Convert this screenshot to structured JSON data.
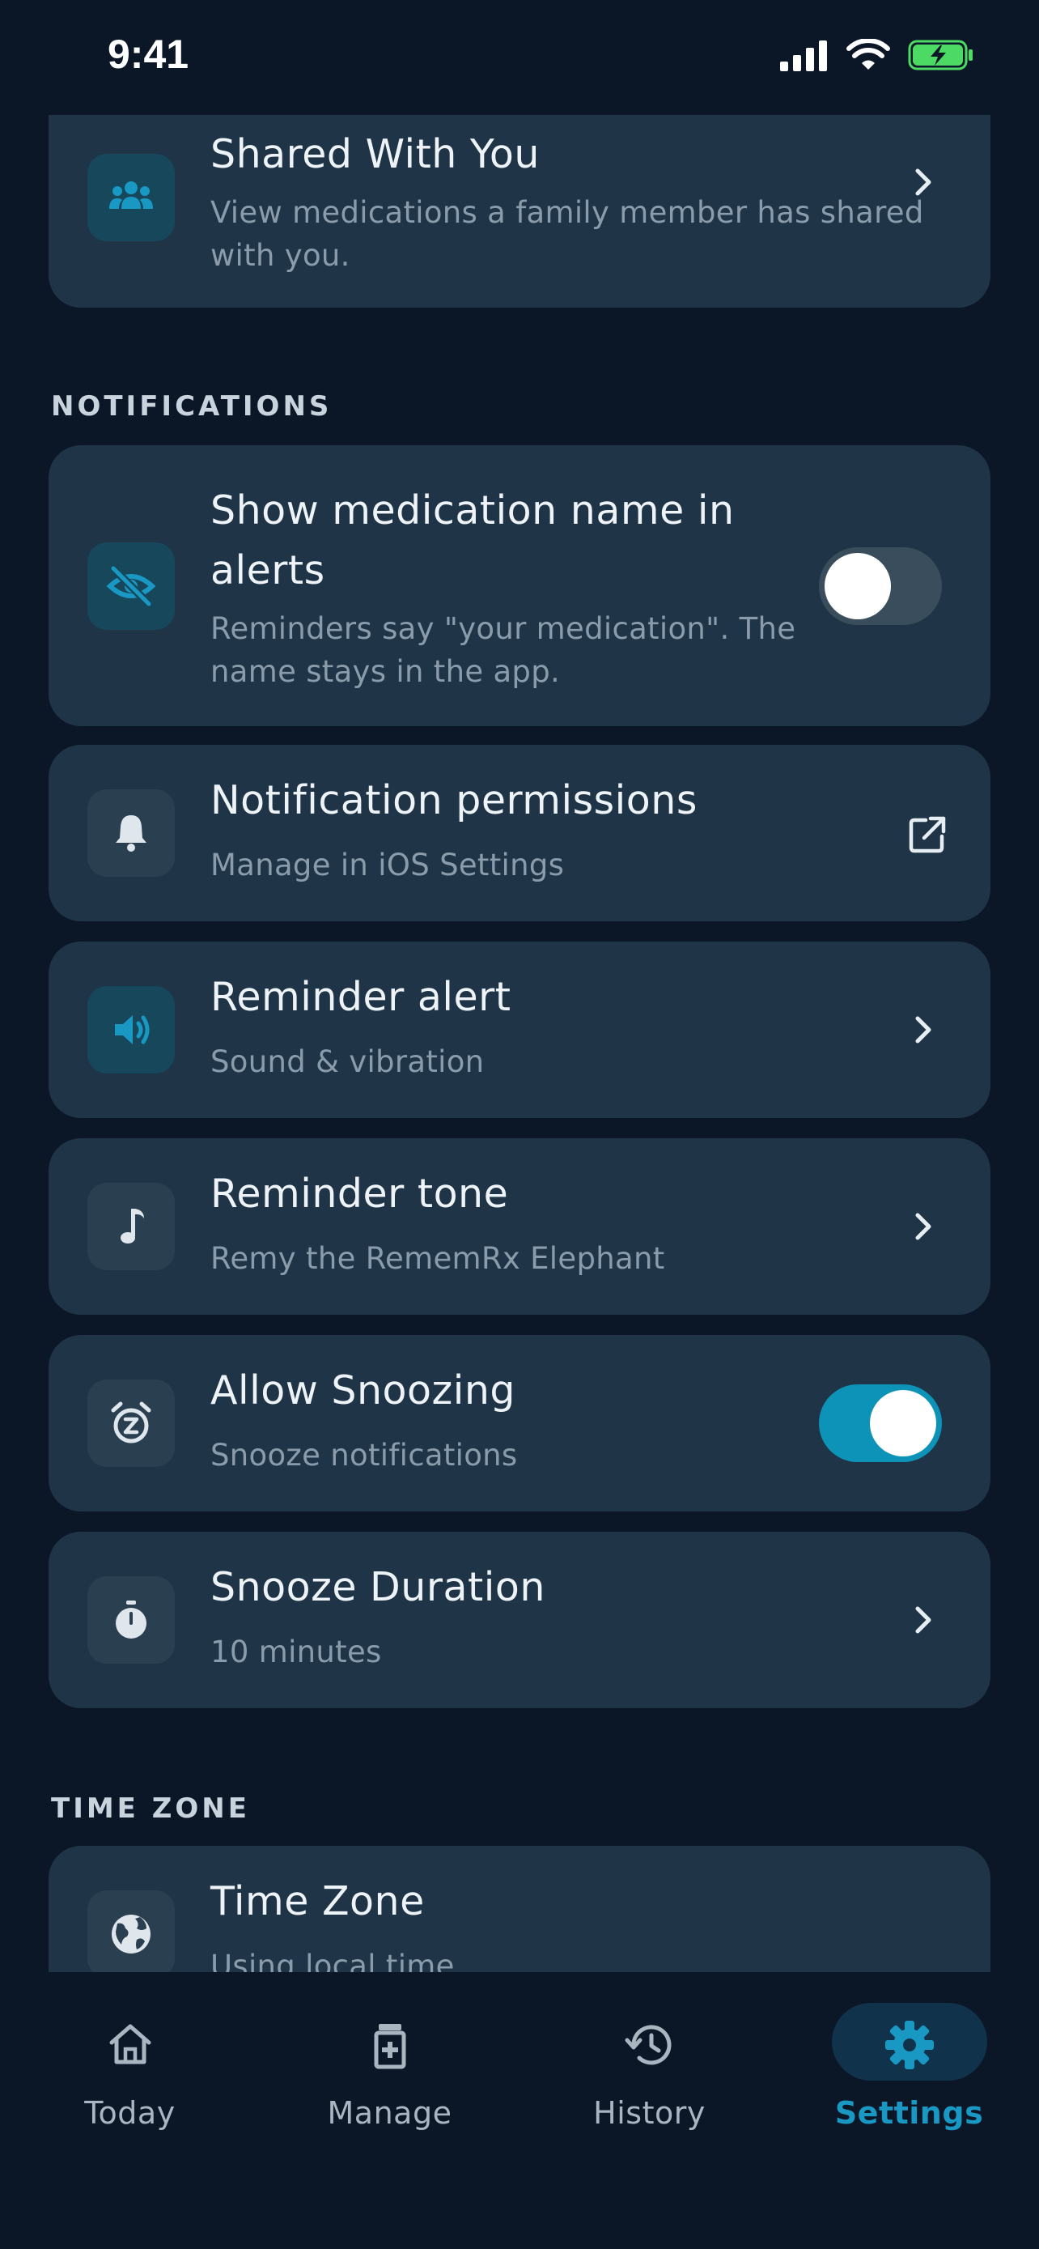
{
  "status_bar": {
    "time": "9:41"
  },
  "cards": {
    "shared": {
      "title": "Shared With You",
      "subtitle_line1": "View medications a family member has shared",
      "subtitle_line2": "with you.",
      "icon": "people-icon"
    },
    "show_name": {
      "title_line1": "Show medication name in",
      "title_line2": "alerts",
      "subtitle_line1": "Reminders say \"your medication\". The",
      "subtitle_line2": "name stays in the app.",
      "icon": "eye-off-icon",
      "toggle_on": false
    },
    "permissions": {
      "title": "Notification permissions",
      "subtitle": "Manage in iOS Settings",
      "icon": "bell-icon"
    },
    "reminder_alert": {
      "title": "Reminder alert",
      "subtitle": "Sound & vibration",
      "icon": "speaker-icon"
    },
    "reminder_tone": {
      "title": "Reminder tone",
      "subtitle": "Remy the RememRx Elephant",
      "icon": "music-note-icon"
    },
    "allow_snoozing": {
      "title": "Allow Snoozing",
      "subtitle": "Snooze notifications",
      "icon": "alarm-snooze-icon",
      "toggle_on": true
    },
    "snooze_duration": {
      "title": "Snooze Duration",
      "subtitle": "10 minutes",
      "icon": "stopwatch-icon"
    },
    "time_zone": {
      "title": "Time Zone",
      "subtitle": "Using local time",
      "icon": "globe-icon"
    }
  },
  "sections": {
    "notifications": "NOTIFICATIONS",
    "time_zone": "TIME ZONE"
  },
  "tab_bar": {
    "tabs": [
      {
        "label": "Today",
        "icon": "home-icon"
      },
      {
        "label": "Manage",
        "icon": "medication-bottle-icon"
      },
      {
        "label": "History",
        "icon": "history-icon"
      },
      {
        "label": "Settings",
        "icon": "gear-icon",
        "active": true
      }
    ]
  },
  "colors": {
    "background": "#0b1627",
    "card": "#1f3547",
    "accent": "#1a98c4",
    "toggle_on": "#0e93b8"
  }
}
